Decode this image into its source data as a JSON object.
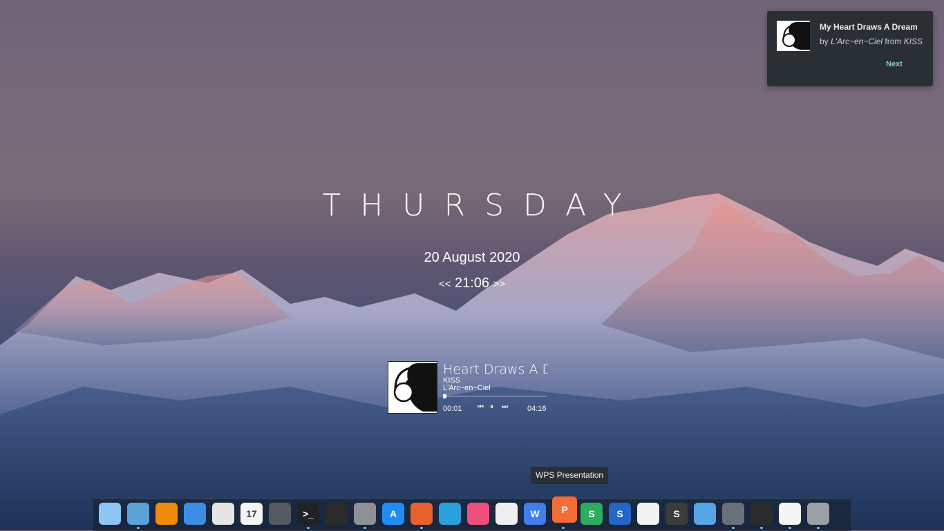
{
  "notification": {
    "title": "My Heart Draws A Dream",
    "by": "by",
    "artist": "L'Arc~en~Ciel",
    "from": "from",
    "album": "KISS",
    "action": "Next"
  },
  "clock": {
    "day": "THURSDAY",
    "date": "20 August 2020",
    "time_prefix": "<<",
    "time": "21:06",
    "time_suffix": ">>"
  },
  "player": {
    "title_visible": "Heart Draws A D",
    "album": "KISS",
    "artist": "L'Arc~en~Ciel",
    "elapsed": "00:01",
    "duration": "04:16",
    "progress": 0.004
  },
  "tooltip": "WPS Presentation",
  "dock": {
    "items": [
      {
        "name": "files",
        "icon": "folder-icon",
        "color": "#8ec5f5"
      },
      {
        "name": "screenshot",
        "icon": "camera-icon",
        "color": "#5aa3d8"
      },
      {
        "name": "vlc",
        "icon": "cone-icon",
        "color": "#f08a0b"
      },
      {
        "name": "finder",
        "icon": "finder-icon",
        "color": "#3a8ee6"
      },
      {
        "name": "trash",
        "icon": "trash-icon",
        "color": "#e6e6e6"
      },
      {
        "name": "calendar",
        "icon": "calendar-icon",
        "color": "#f4f4f4",
        "text": "17"
      },
      {
        "name": "calculator",
        "icon": "calculator-icon",
        "color": "#555a60"
      },
      {
        "name": "terminal",
        "icon": "terminal-icon",
        "color": "#202326",
        "text": ">_"
      },
      {
        "name": "system-monitor",
        "icon": "monitor-icon",
        "color": "#2b2b2b"
      },
      {
        "name": "settings",
        "icon": "gear-icon",
        "color": "#8e9196"
      },
      {
        "name": "app-store",
        "icon": "app-store-icon",
        "color": "#1e8ef6",
        "text": "A"
      },
      {
        "name": "firefox",
        "icon": "firefox-icon",
        "color": "#e8602c"
      },
      {
        "name": "telegram",
        "icon": "telegram-icon",
        "color": "#2aa0da"
      },
      {
        "name": "audio",
        "icon": "waveform-icon",
        "color": "#ee4f7d"
      },
      {
        "name": "inkscape",
        "icon": "inkscape-icon",
        "color": "#efefef"
      },
      {
        "name": "wps-writer",
        "icon": "wps-writer-icon",
        "color": "#3f7ff0",
        "text": "W"
      },
      {
        "name": "wps-presentation",
        "icon": "wps-presentation-icon",
        "color": "#f36d35",
        "text": "P"
      },
      {
        "name": "wps-spreadsheet",
        "icon": "wps-spreadsheet-icon",
        "color": "#2eab5e",
        "text": "S"
      },
      {
        "name": "simplenote",
        "icon": "simplenote-icon",
        "color": "#2266c9",
        "text": "S"
      },
      {
        "name": "photos",
        "icon": "photos-icon",
        "color": "#f3f3f3"
      },
      {
        "name": "sublime-text",
        "icon": "sublime-icon",
        "color": "#3b3b3b",
        "text": "S"
      },
      {
        "name": "search",
        "icon": "search-icon",
        "color": "#56a3e6"
      },
      {
        "name": "disk-utility",
        "icon": "disk-icon",
        "color": "#6a7078"
      },
      {
        "name": "dashboard",
        "icon": "gauge-icon",
        "color": "#2b2b2b"
      },
      {
        "name": "music",
        "icon": "music-note-icon",
        "color": "#f5f5f7"
      },
      {
        "name": "window",
        "icon": "window-icon",
        "color": "#9aa0a6"
      }
    ],
    "running": [
      "screenshot",
      "terminal",
      "settings",
      "firefox",
      "wps-presentation",
      "disk-utility",
      "dashboard",
      "music",
      "window"
    ]
  }
}
